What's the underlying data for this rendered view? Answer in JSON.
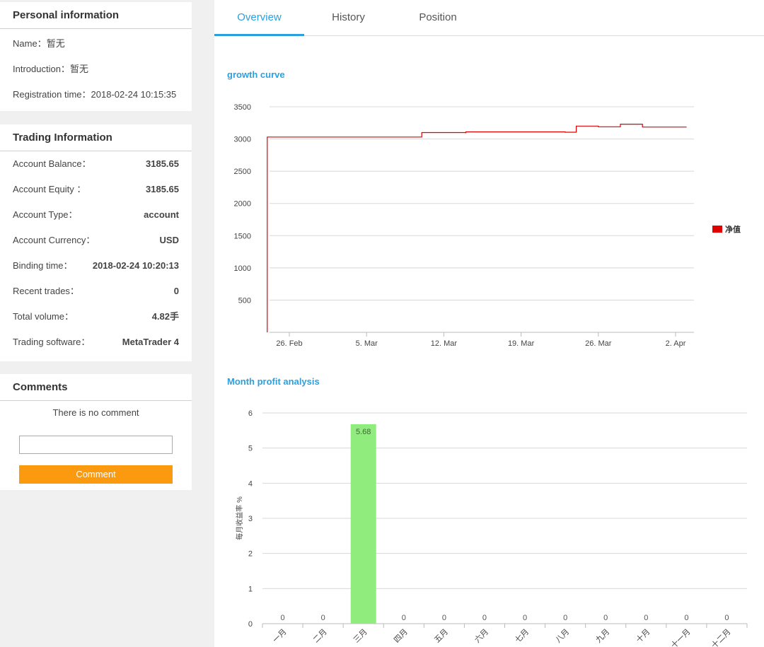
{
  "personal": {
    "title": "Personal information",
    "rows": [
      {
        "label": "Name：",
        "value": "暂无"
      },
      {
        "label": "Introduction：",
        "value": "暂无"
      },
      {
        "label": "Registration time：",
        "value": "2018-02-24 10:15:35"
      }
    ]
  },
  "trading": {
    "title": "Trading Information",
    "rows": [
      {
        "label": "Account Balance：",
        "value": "3185.65"
      },
      {
        "label": "Account Equity ：",
        "value": "3185.65"
      },
      {
        "label": "Account Type：",
        "value": "account"
      },
      {
        "label": "Account Currency：",
        "value": "USD"
      },
      {
        "label": "Binding time：",
        "value": "2018-02-24 10:20:13"
      },
      {
        "label": "Recent trades：",
        "value": "0"
      },
      {
        "label": "Total volume：",
        "value": "4.82手"
      },
      {
        "label": "Trading software：",
        "value": "MetaTrader 4"
      }
    ]
  },
  "comments": {
    "title": "Comments",
    "empty_text": "There is no comment",
    "input_value": "",
    "button_label": "Comment"
  },
  "tabs": [
    {
      "label": "Overview",
      "active": true
    },
    {
      "label": "History",
      "active": false
    },
    {
      "label": "Position",
      "active": false
    }
  ],
  "colors": {
    "accent": "#2aa0de",
    "button": "#fb9a0e",
    "line": "#e00000",
    "bar": "#90ed7d"
  },
  "chart_data": [
    {
      "type": "line",
      "title": "growth curve",
      "ylim": [
        0,
        3500
      ],
      "yticks": [
        500,
        1000,
        1500,
        2000,
        2500,
        3000,
        3500
      ],
      "xticks": [
        "26. Feb",
        "5. Mar",
        "12. Mar",
        "19. Mar",
        "26. Mar",
        "2. Apr"
      ],
      "legend": {
        "position": "right",
        "entries": [
          "净值"
        ]
      },
      "series": [
        {
          "name": "净值",
          "x": [
            "2018-02-24",
            "2018-02-24",
            "2018-03-10",
            "2018-03-10",
            "2018-03-14",
            "2018-03-14",
            "2018-03-23",
            "2018-03-24",
            "2018-03-24",
            "2018-03-26",
            "2018-03-28",
            "2018-03-28",
            "2018-03-30",
            "2018-03-30",
            "2018-04-03"
          ],
          "values": [
            0,
            3030,
            3030,
            3100,
            3090,
            3110,
            3105,
            3160,
            3200,
            3190,
            3195,
            3230,
            3215,
            3185,
            3185
          ]
        }
      ],
      "grid": true
    },
    {
      "type": "bar",
      "title": "Month profit analysis",
      "ylabel": "每月收益率 %",
      "ylim": [
        0,
        6
      ],
      "yticks": [
        0,
        1,
        2,
        3,
        4,
        5,
        6
      ],
      "categories": [
        "一月",
        "二月",
        "三月",
        "四月",
        "五月",
        "六月",
        "七月",
        "八月",
        "九月",
        "十月",
        "十一月",
        "十二月"
      ],
      "values": [
        0,
        0,
        5.68,
        0,
        0,
        0,
        0,
        0,
        0,
        0,
        0,
        0
      ],
      "grid": true
    }
  ]
}
